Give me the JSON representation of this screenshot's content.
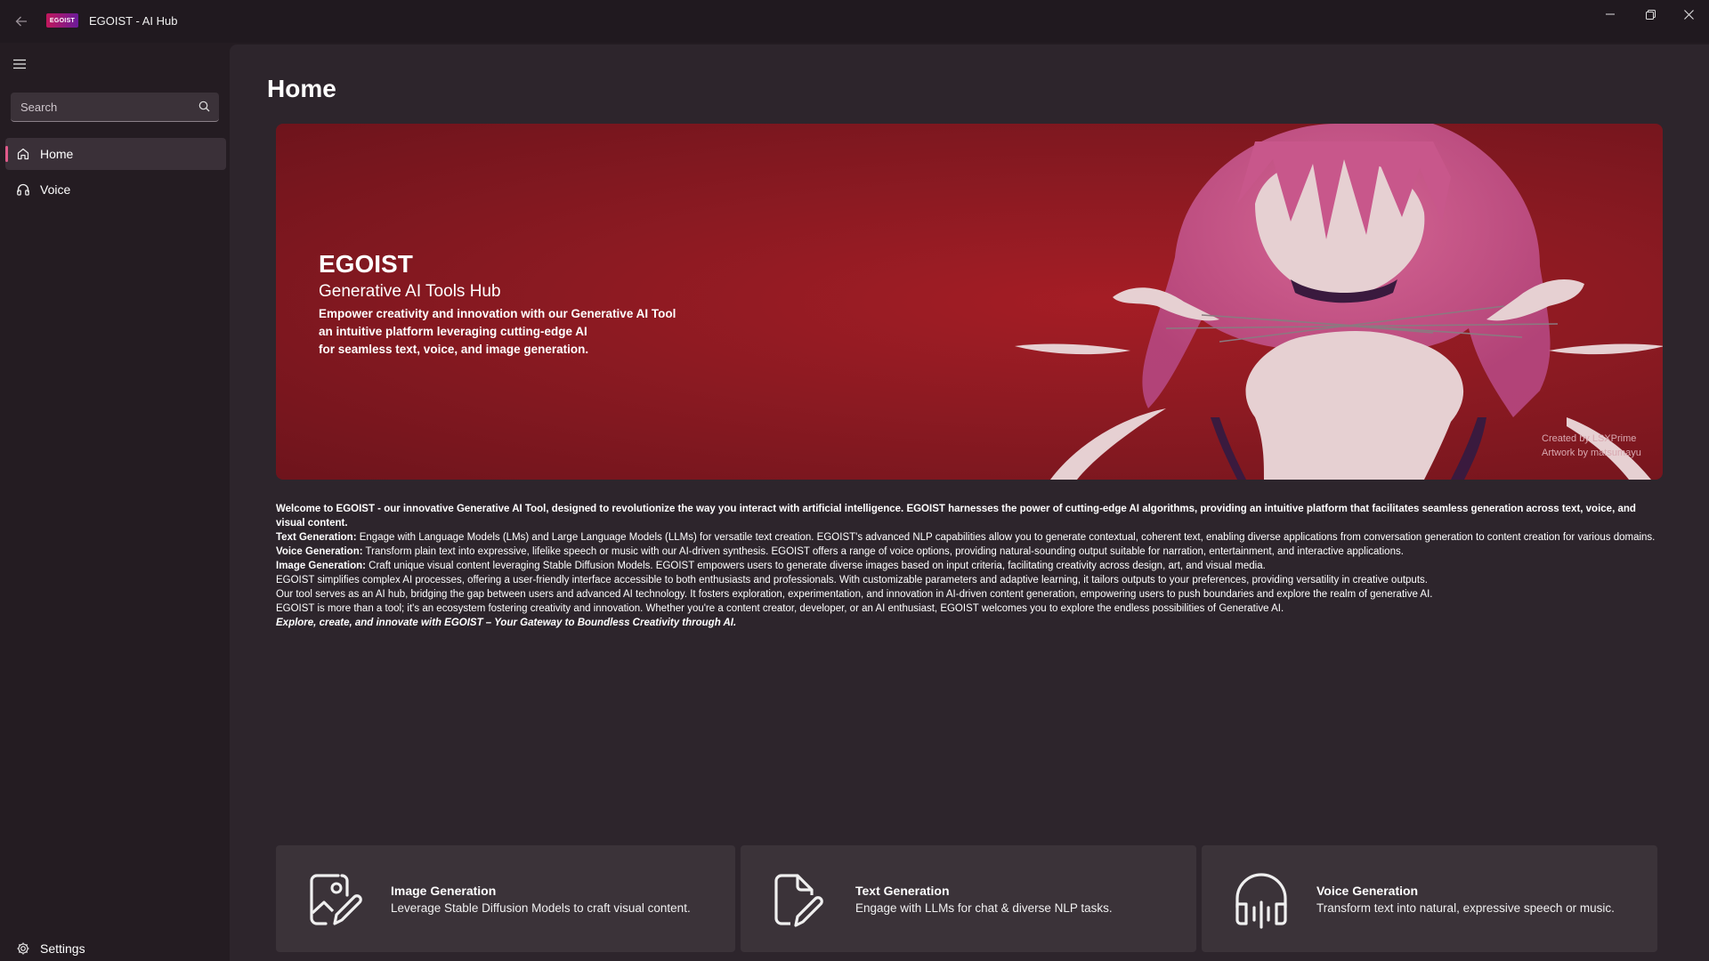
{
  "window": {
    "title": "EGOIST - AI Hub",
    "logo_text": "EGOIST"
  },
  "sidebar": {
    "search": {
      "placeholder": "Search"
    },
    "items": [
      {
        "label": "Home",
        "icon": "home-icon",
        "active": true
      },
      {
        "label": "Voice",
        "icon": "headphones-icon",
        "active": false
      }
    ],
    "settings_label": "Settings"
  },
  "main": {
    "page_title": "Home",
    "hero": {
      "title": "EGOIST",
      "subtitle": "Generative AI Tools Hub",
      "desc_line1": "Empower creativity and innovation with our Generative AI Tool",
      "desc_line2": "an intuitive platform leveraging cutting-edge AI",
      "desc_line3": "for seamless text, voice, and image generation.",
      "credit_line1": "Created by LSXPrime",
      "credit_line2": "Artwork by matsumayu"
    },
    "about": {
      "intro": "Welcome to EGOIST - our innovative Generative AI Tool, designed to revolutionize the way you interact with artificial intelligence. EGOIST harnesses the power of cutting-edge AI algorithms, providing an intuitive platform that facilitates seamless generation across text, voice, and visual content.",
      "text_label": "Text Generation:",
      "text_body": " Engage with Language Models (LMs) and Large Language Models (LLMs) for versatile text creation. EGOIST's advanced NLP capabilities allow you to generate contextual, coherent text, enabling diverse applications from conversation generation to content creation for various domains.",
      "voice_label": "Voice Generation:",
      "voice_body": " Transform plain text into expressive, lifelike speech or music with our AI-driven synthesis. EGOIST offers a range of voice options, providing natural-sounding output suitable for narration, entertainment, and interactive applications.",
      "image_label": "Image Generation:",
      "image_body": " Craft unique visual content leveraging Stable Diffusion Models. EGOIST empowers users to generate diverse images based on input criteria, facilitating creativity across design, art, and visual media.",
      "p1": "EGOIST simplifies complex AI processes, offering a user-friendly interface accessible to both enthusiasts and professionals. With customizable parameters and adaptive learning, it tailors outputs to your preferences, providing versatility in creative outputs.",
      "p2": "Our tool serves as an AI hub, bridging the gap between users and advanced AI technology. It fosters exploration, experimentation, and innovation in AI-driven content generation, empowering users to push boundaries and explore the realm of generative AI.",
      "p3": "EGOIST is more than a tool; it's an ecosystem fostering creativity and innovation. Whether you're a content creator, developer, or an AI enthusiast, EGOIST welcomes you to explore the endless possibilities of Generative AI.",
      "closing": "Explore, create, and innovate with EGOIST – Your Gateway to Boundless Creativity through AI."
    },
    "cards": [
      {
        "title": "Image Generation",
        "desc": "Leverage Stable Diffusion Models to craft visual content.",
        "icon": "image-edit-icon"
      },
      {
        "title": "Text Generation",
        "desc": "Engage with LLMs  for chat & diverse NLP tasks.",
        "icon": "document-edit-icon"
      },
      {
        "title": "Voice Generation",
        "desc": "Transform text into natural, expressive speech or music.",
        "icon": "headphones-wave-icon"
      }
    ]
  },
  "colors": {
    "accent": "#e05a8a",
    "hero_red": "#8c1a22",
    "sidebar_bg": "#241c22",
    "content_bg": "#2d252c",
    "card_bg": "#3b3339"
  }
}
